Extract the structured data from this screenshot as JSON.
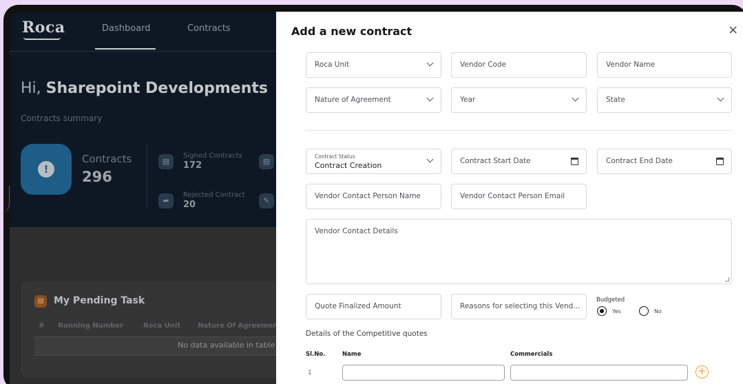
{
  "dashboard": {
    "logo": "Roca",
    "nav": [
      "Dashboard",
      "Contracts"
    ],
    "greeting_prefix": "Hi,",
    "greeting_name": "Sharepoint Developments",
    "summary_label": "Contracts summary",
    "contracts_label": "Contracts",
    "contracts_count": "296",
    "stats": [
      {
        "label": "Signed Contracts",
        "value": "172"
      },
      {
        "label": "Rejected Contract",
        "value": "20"
      }
    ],
    "pending": {
      "title": "My Pending Task",
      "columns": [
        "#",
        "Running Number",
        "Roca Unit",
        "Nature Of Agreement"
      ],
      "empty": "No data available in table"
    }
  },
  "modal": {
    "title": "Add a new contract",
    "close": "×",
    "fields": {
      "roca_unit": "Roca Unit",
      "vendor_code": "Vendor Code",
      "vendor_name": "Vendor Name",
      "nature": "Nature of Agreement",
      "year": "Year",
      "state": "State",
      "status_label": "Contract Status",
      "status_value": "Contract Creation",
      "start_date": "Contract Start Date",
      "end_date": "Contract End Date",
      "contact_name": "Vendor Contact Person Name",
      "contact_email": "Vendor Contact Person Email",
      "contact_details": "Vendor Contact Details",
      "quote_amount": "Quote Finalized Amount",
      "reasons": "Reasons for selecting this Vend..."
    },
    "budgeted": {
      "label": "Budgeted",
      "yes": "Yes",
      "no": "No",
      "selected": "Yes"
    },
    "quotes": {
      "section": "Details of the Competitive quotes",
      "columns": [
        "Sl.No.",
        "Name",
        "Commercials"
      ],
      "rows": [
        {
          "no": "1"
        }
      ],
      "add": "+"
    }
  }
}
